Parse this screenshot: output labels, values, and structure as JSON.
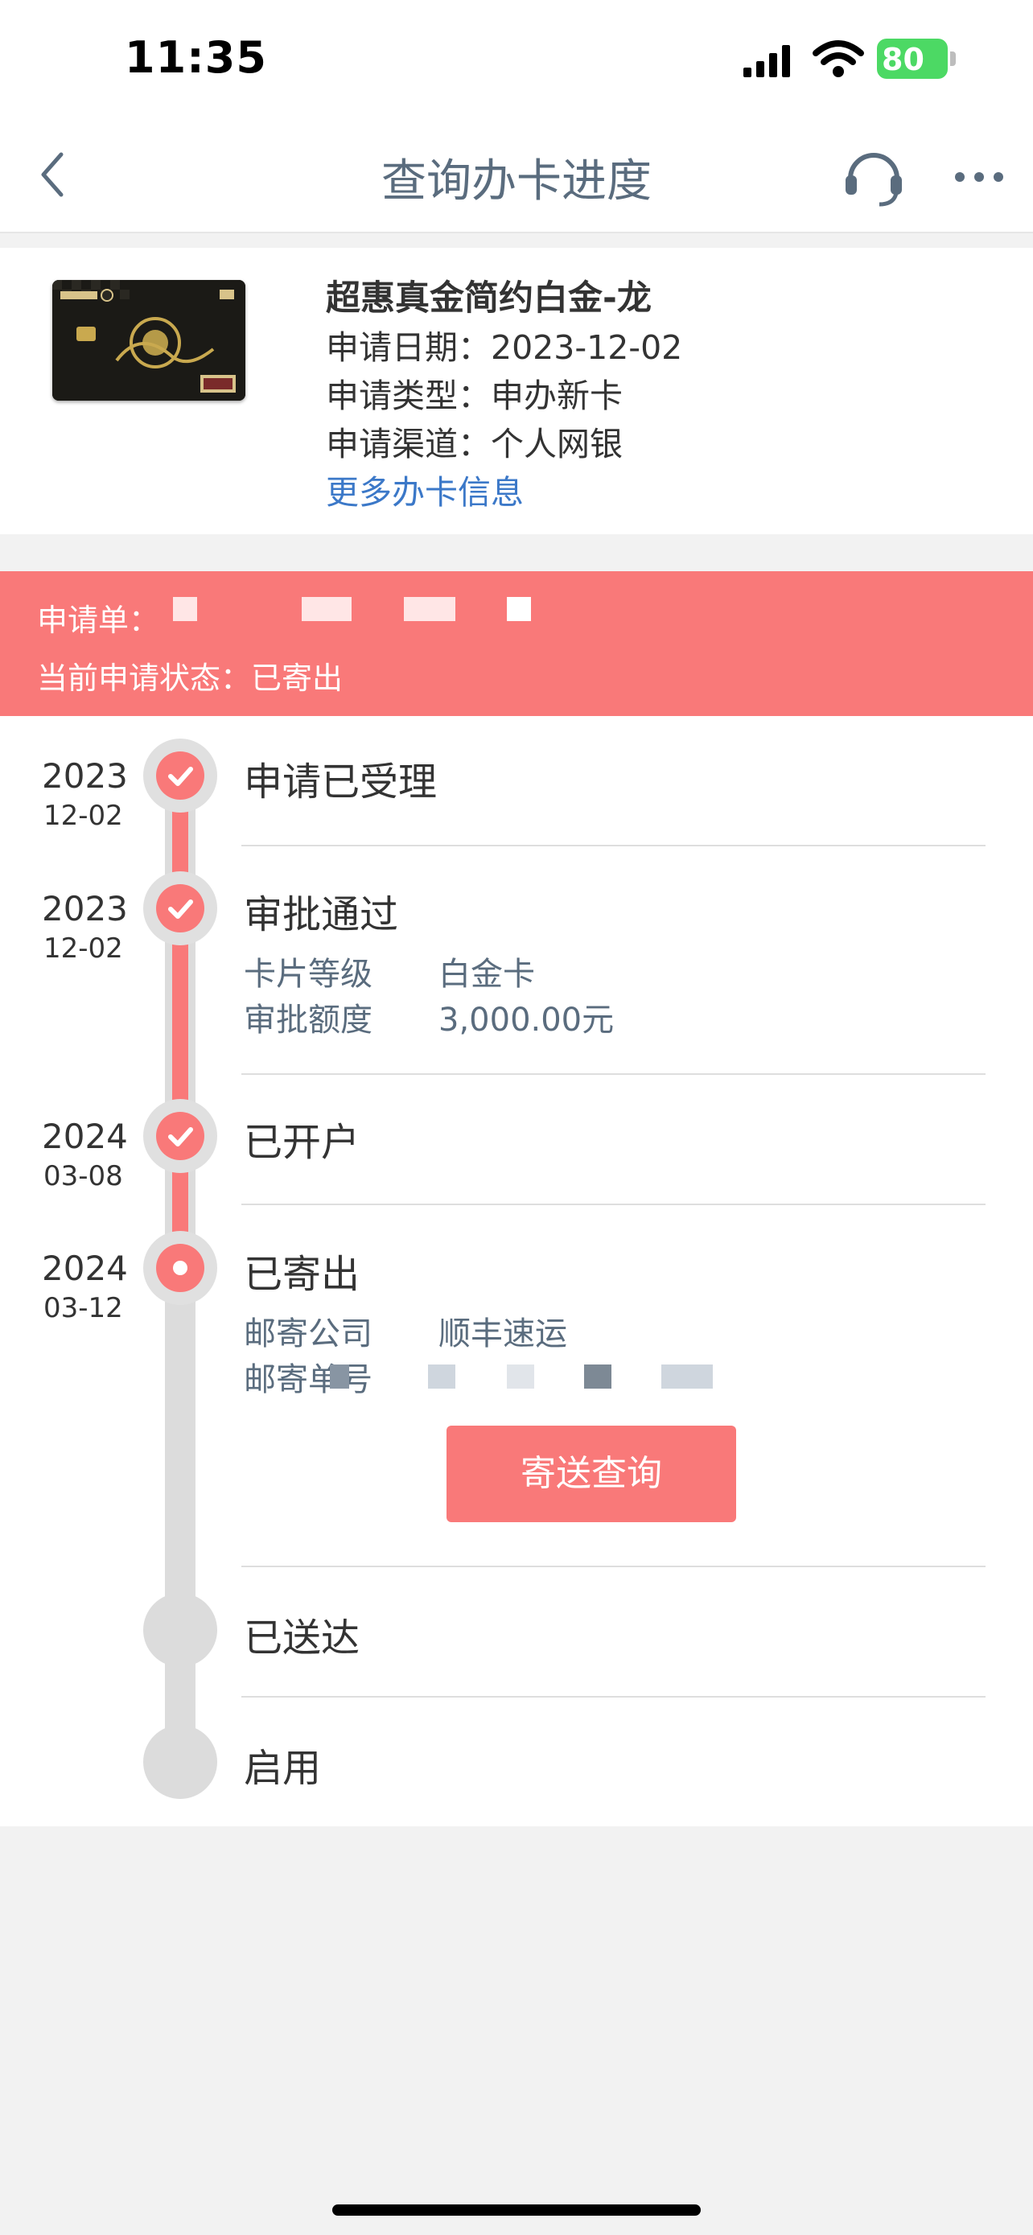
{
  "status_bar": {
    "time": "11:35",
    "battery": "80"
  },
  "nav": {
    "title": "查询办卡进度"
  },
  "card": {
    "name": "超惠真金简约白金-龙",
    "apply_date": "申请日期：2023-12-02",
    "apply_type": "申请类型：申办新卡",
    "apply_channel": "申请渠道：个人网银",
    "more_link": "更多办卡信息"
  },
  "banner": {
    "application_label": "申请单：",
    "status_line": "当前申请状态：已寄出",
    "color": "#f97979"
  },
  "timeline": {
    "steps": [
      {
        "year": "2023",
        "md": "12-02",
        "title": "申请已受理",
        "state": "done"
      },
      {
        "year": "2023",
        "md": "12-02",
        "title": "审批通过",
        "state": "done",
        "details": [
          {
            "label": "卡片等级",
            "value": "白金卡"
          },
          {
            "label": "审批额度",
            "value": "3,000.00元"
          }
        ]
      },
      {
        "year": "2024",
        "md": "03-08",
        "title": "已开户",
        "state": "done"
      },
      {
        "year": "2024",
        "md": "03-12",
        "title": "已寄出",
        "state": "current",
        "details": [
          {
            "label": "邮寄公司",
            "value": "顺丰速运"
          },
          {
            "label": "邮寄单号",
            "value": ""
          }
        ]
      },
      {
        "year": "",
        "md": "",
        "title": "已送达",
        "state": "pending"
      },
      {
        "year": "",
        "md": "",
        "title": "启用",
        "state": "pending"
      }
    ],
    "track_button": "寄送查询"
  }
}
